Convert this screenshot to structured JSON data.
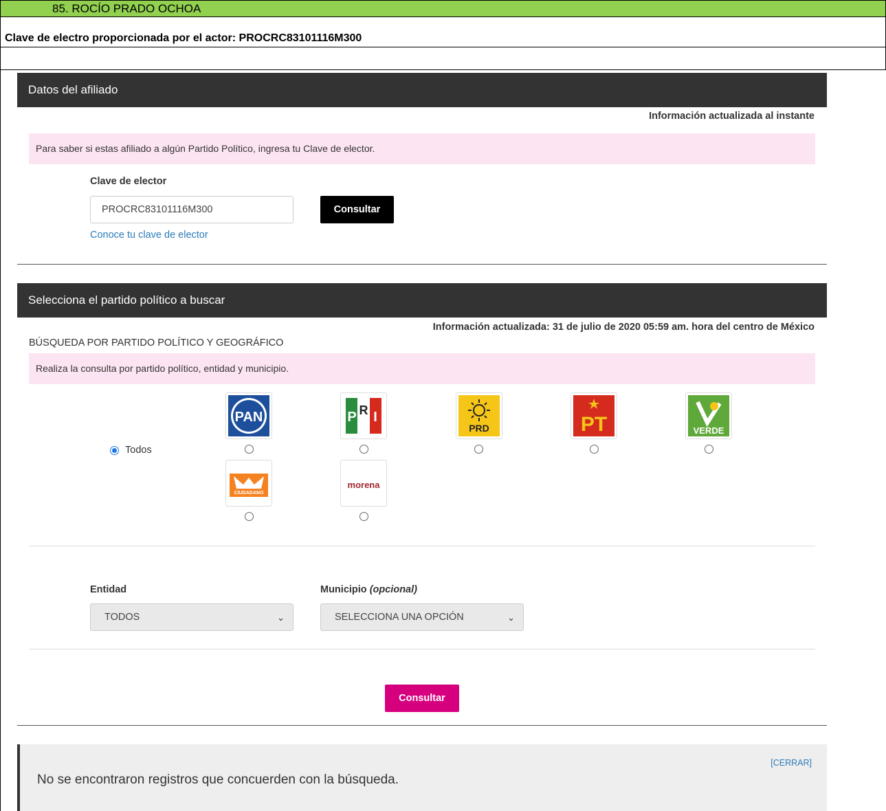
{
  "header": {
    "title": "85.  ROCÍO PRADO OCHOA",
    "subtitle": "Clave de electro proporcionada por el actor: PROCRC83101116M300"
  },
  "afiliado": {
    "section_title": "Datos del afiliado",
    "update_info": "Información actualizada al instante",
    "notice": "Para saber si estas afiliado a algún Partido Político, ingresa tu Clave de elector.",
    "field_label": "Clave de elector",
    "field_value": "PROCRC83101116M300",
    "button_label": "Consultar",
    "help_link": "Conoce tu clave de elector"
  },
  "partido": {
    "section_title": "Selecciona el partido político a buscar",
    "update_info": "Información actualizada: 31 de julio de 2020 05:59 am. hora del centro de México",
    "search_heading": "BÚSQUEDA POR PARTIDO POLÍTICO Y GEOGRÁFICO",
    "notice": "Realiza la consulta por partido político, entidad y municipio.",
    "todos_label": "Todos",
    "parties": [
      {
        "name": "PAN",
        "icon": "pan-logo-icon"
      },
      {
        "name": "PRI",
        "icon": "pri-logo-icon"
      },
      {
        "name": "PRD",
        "icon": "prd-logo-icon"
      },
      {
        "name": "PT",
        "icon": "pt-logo-icon"
      },
      {
        "name": "VERDE",
        "icon": "verde-logo-icon"
      },
      {
        "name": "MOVIMIENTO CIUDADANO",
        "icon": "mc-logo-icon"
      },
      {
        "name": "morena",
        "icon": "morena-logo-icon"
      }
    ],
    "entidad_label": "Entidad",
    "entidad_value": "TODOS",
    "municipio_label": "Municipio",
    "municipio_optional": "(opcional)",
    "municipio_value": "SELECCIONA UNA OPCIÓN",
    "button_label": "Consultar"
  },
  "result": {
    "message": "No se encontraron registros que concuerden con la búsqueda.",
    "close_label": "[CERRAR]"
  },
  "colors": {
    "header_green": "#92d050",
    "section_dark": "#333333",
    "notice_pink": "#fce4f2",
    "accent_magenta": "#d6007f",
    "link_blue": "#2b7bb9"
  }
}
